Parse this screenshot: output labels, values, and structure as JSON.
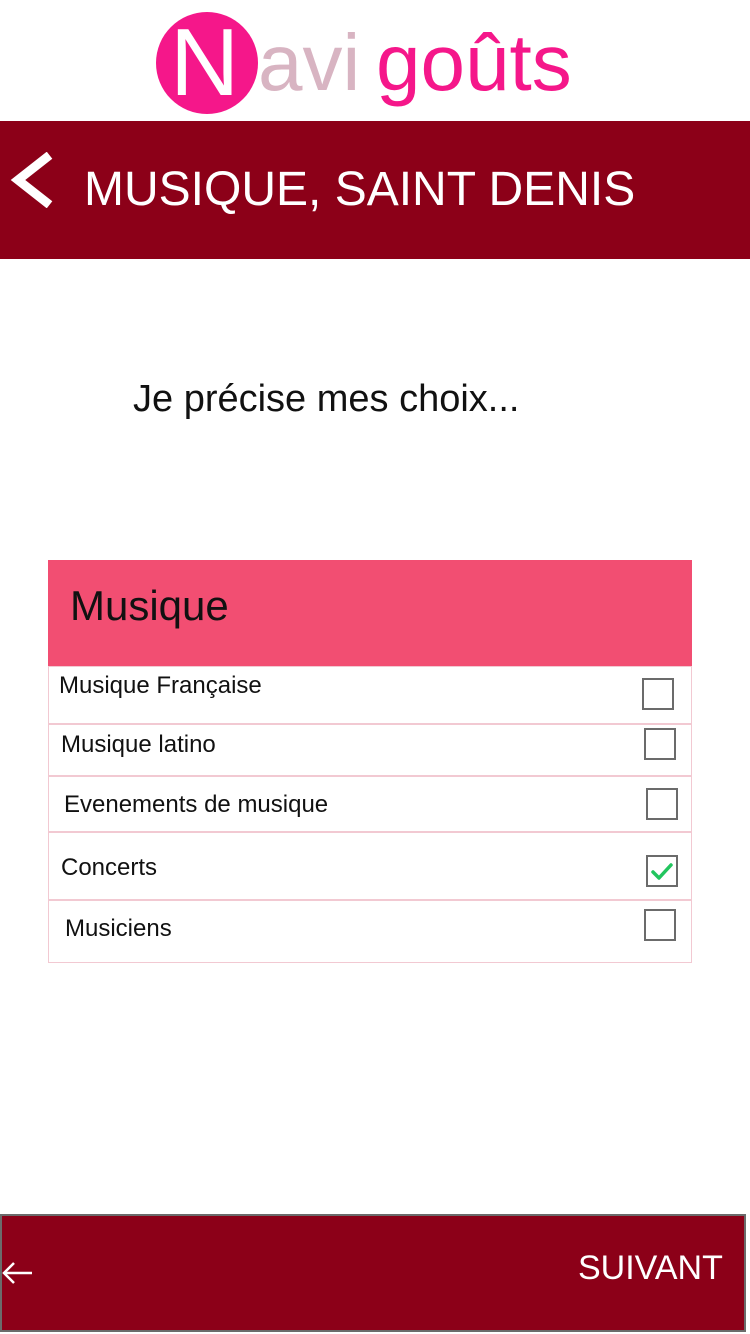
{
  "logo": {
    "first_letter": "N",
    "part_light": "avi",
    "part_pink": "goûts"
  },
  "header": {
    "title": "MUSIQUE, SAINT DENIS"
  },
  "main": {
    "subtitle": "Je précise mes choix...",
    "category": {
      "title": "Musique",
      "options": [
        {
          "label": "Musique Française",
          "checked": false
        },
        {
          "label": "Musique latino",
          "checked": false
        },
        {
          "label": "Evenements de musique",
          "checked": false
        },
        {
          "label": "Concerts",
          "checked": true
        },
        {
          "label": "Musiciens",
          "checked": false
        }
      ]
    }
  },
  "footer": {
    "next_label": "SUIVANT"
  },
  "colors": {
    "brand_pink": "#f5178a",
    "logo_light": "#d8b4c2",
    "bar": "#8c0018",
    "category_header": "#f24e72",
    "check": "#22c55e"
  },
  "icons": {
    "back_header": "chevron-left-icon",
    "back_footer": "arrow-left-icon",
    "check": "checkmark-icon"
  }
}
